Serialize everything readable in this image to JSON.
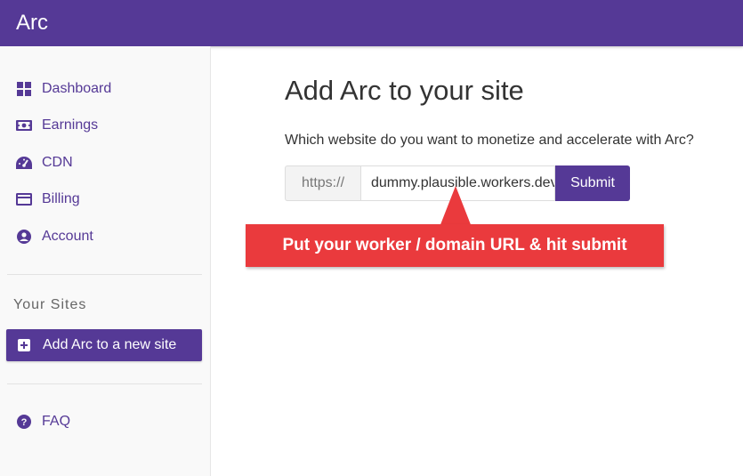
{
  "app": {
    "title": "Arc",
    "brand_color": "#553996"
  },
  "sidebar": {
    "items": [
      {
        "label": "Dashboard",
        "icon": "dashboard-icon"
      },
      {
        "label": "Earnings",
        "icon": "money-icon"
      },
      {
        "label": "CDN",
        "icon": "speedometer-icon"
      },
      {
        "label": "Billing",
        "icon": "credit-card-icon"
      },
      {
        "label": "Account",
        "icon": "user-circle-icon"
      }
    ],
    "section_title": "Your Sites",
    "active_item": {
      "label": "Add Arc to a new site",
      "icon": "plus-square-icon"
    },
    "faq": {
      "label": "FAQ",
      "icon": "question-circle-icon"
    }
  },
  "main": {
    "title": "Add Arc to your site",
    "question": "Which website do you want to monetize and accelerate with Arc?",
    "url_prefix": "https://",
    "url_value": "dummy.plausible.workers.dev",
    "submit_label": "Submit"
  },
  "annotation": {
    "text": "Put your worker / domain URL & hit submit",
    "color": "#ea3a3d"
  }
}
